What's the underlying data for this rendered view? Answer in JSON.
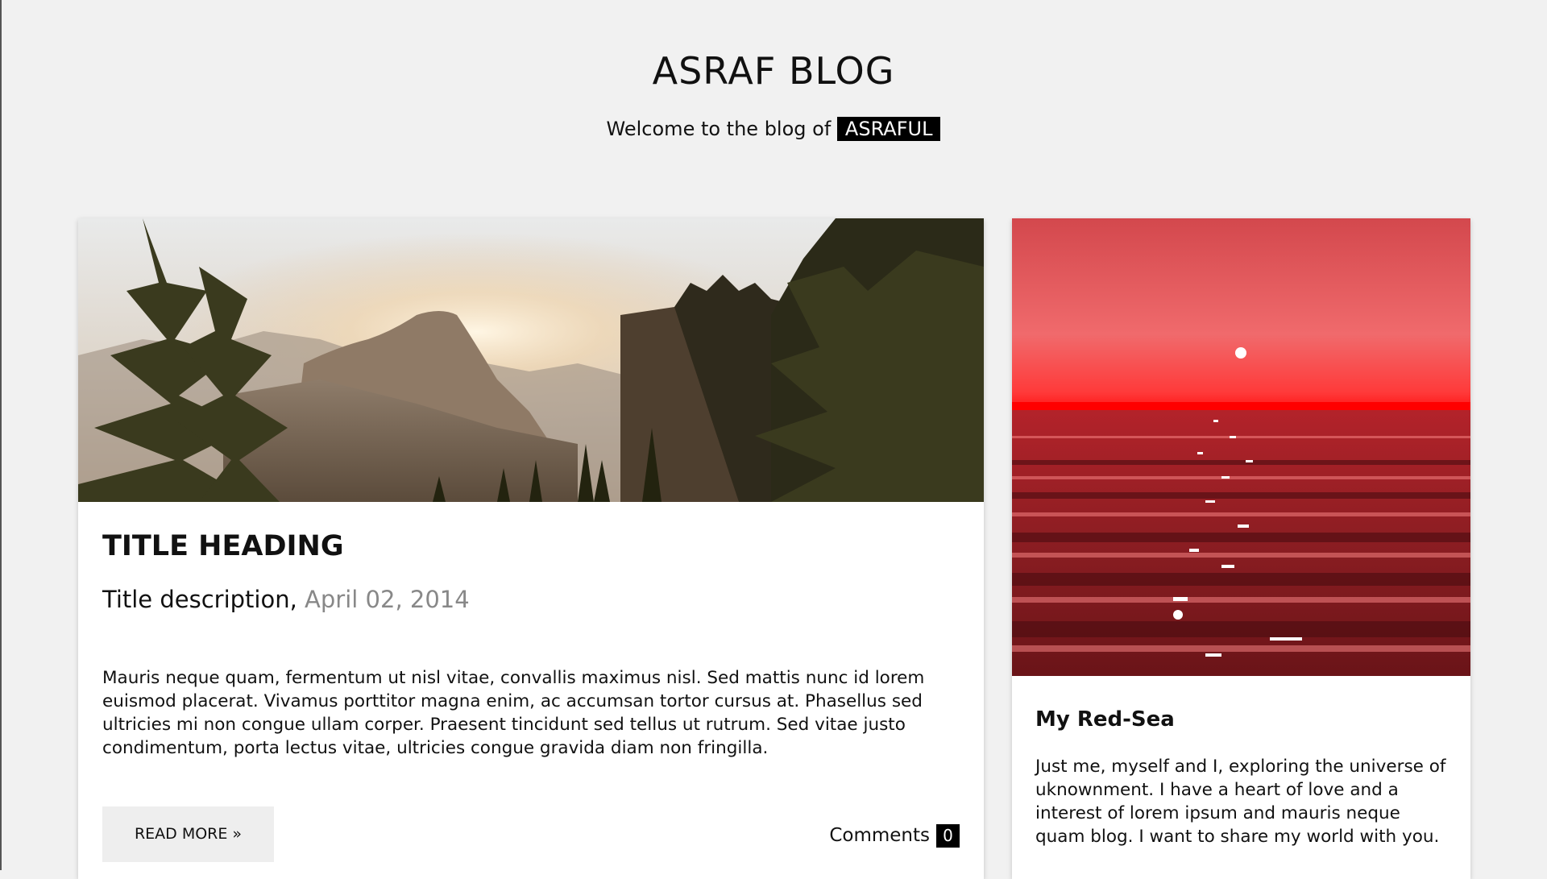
{
  "header": {
    "title": "ASRAF BLOG",
    "tagline_prefix": "Welcome to the blog of",
    "tagline_name": "ASRAFUL"
  },
  "main_post": {
    "image": "forest-sunrise-photo",
    "title": "TITLE HEADING",
    "subtitle": "Title description,",
    "date": "April 02, 2014",
    "body": "Mauris neque quam, fermentum ut nisl vitae, convallis maximus nisl. Sed mattis nunc id lorem euismod placerat. Vivamus porttitor magna enim, ac accumsan tortor cursus at. Phasellus sed ultricies mi non congue ullam corper. Praesent tincidunt sed tellus ut rutrum. Sed vitae justo condimentum, porta lectus vitae, ultricies congue gravida diam non fringilla.",
    "read_more_label": "READ MORE »",
    "comments_label": "Comments",
    "comments_count": "0"
  },
  "side_card": {
    "image": "red-sea-sunset-photo",
    "title": "My Red-Sea",
    "body": "Just me, myself and I, exploring the universe of uknownment. I have a heart of love and a interest of lorem ipsum and mauris neque quam blog. I want to share my world with you."
  },
  "colors": {
    "background": "#f1f1f1",
    "card": "#ffffff",
    "accent": "#000000",
    "date": "#888888",
    "button": "#eeeeee"
  }
}
